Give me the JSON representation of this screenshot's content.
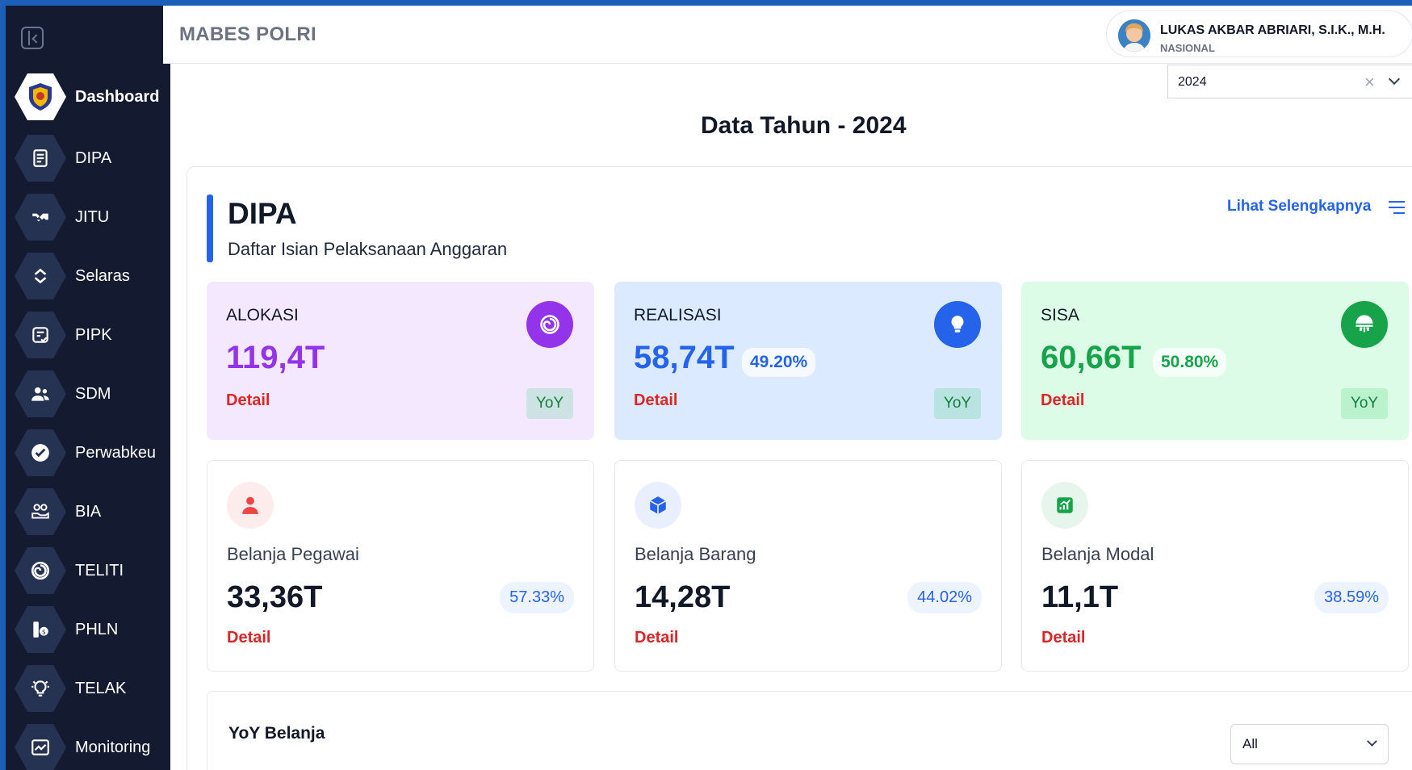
{
  "header": {
    "title": "MABES POLRI",
    "user_name": "LUKAS AKBAR ABRIARI, S.I.K., M.H.",
    "user_role": "NASIONAL"
  },
  "sidebar": {
    "items": [
      {
        "label": "Dashboard",
        "icon": "logo-shield-icon"
      },
      {
        "label": "DIPA",
        "icon": "document-icon"
      },
      {
        "label": "JITU",
        "icon": "handshake-icon"
      },
      {
        "label": "Selaras",
        "icon": "sync-icon"
      },
      {
        "label": "PIPK",
        "icon": "checklist-icon"
      },
      {
        "label": "SDM",
        "icon": "people-icon"
      },
      {
        "label": "Perwabkeu",
        "icon": "check-circle-icon"
      },
      {
        "label": "BIA",
        "icon": "budget-hand-icon"
      },
      {
        "label": "TELITI",
        "icon": "swirl-icon"
      },
      {
        "label": "PHLN",
        "icon": "money-hand-icon"
      },
      {
        "label": "TELAK",
        "icon": "lightbulb-icon"
      },
      {
        "label": "Monitoring",
        "icon": "chart-icon"
      }
    ]
  },
  "year_filter": {
    "value": "2024",
    "clear": "×"
  },
  "page_title": "Data Tahun - 2024",
  "dipa": {
    "title": "DIPA",
    "subtitle": "Daftar Isian Pelaksanaan Anggaran",
    "see_more": "Lihat Selengkapnya",
    "stats": [
      {
        "label": "ALOKASI",
        "value": "119,4T",
        "percent": "",
        "detail": "Detail",
        "yoy": "YoY",
        "color": "#9333ea",
        "bg": "#f3e8ff",
        "icon": "swirl-icon"
      },
      {
        "label": "REALISASI",
        "value": "58,74T",
        "percent": "49.20%",
        "detail": "Detail",
        "yoy": "YoY",
        "color": "#2563eb",
        "bg": "#dbeafe",
        "icon": "lightbulb-icon"
      },
      {
        "label": "SISA",
        "value": "60,66T",
        "percent": "50.80%",
        "detail": "Detail",
        "yoy": "YoY",
        "color": "#16a34a",
        "bg": "#dcfce7",
        "icon": "pie-icon"
      }
    ],
    "spending": [
      {
        "label": "Belanja Pegawai",
        "value": "33,36T",
        "percent": "57.33%",
        "detail": "Detail",
        "icon": "person-icon",
        "color": "#ef4444"
      },
      {
        "label": "Belanja Barang",
        "value": "14,28T",
        "percent": "44.02%",
        "detail": "Detail",
        "icon": "box-icon",
        "color": "#2563eb"
      },
      {
        "label": "Belanja Modal",
        "value": "11,1T",
        "percent": "38.59%",
        "detail": "Detail",
        "icon": "growth-chart-icon",
        "color": "#16a34a"
      }
    ]
  },
  "yoy_belanja": {
    "title": "YoY Belanja",
    "filter_value": "All"
  }
}
